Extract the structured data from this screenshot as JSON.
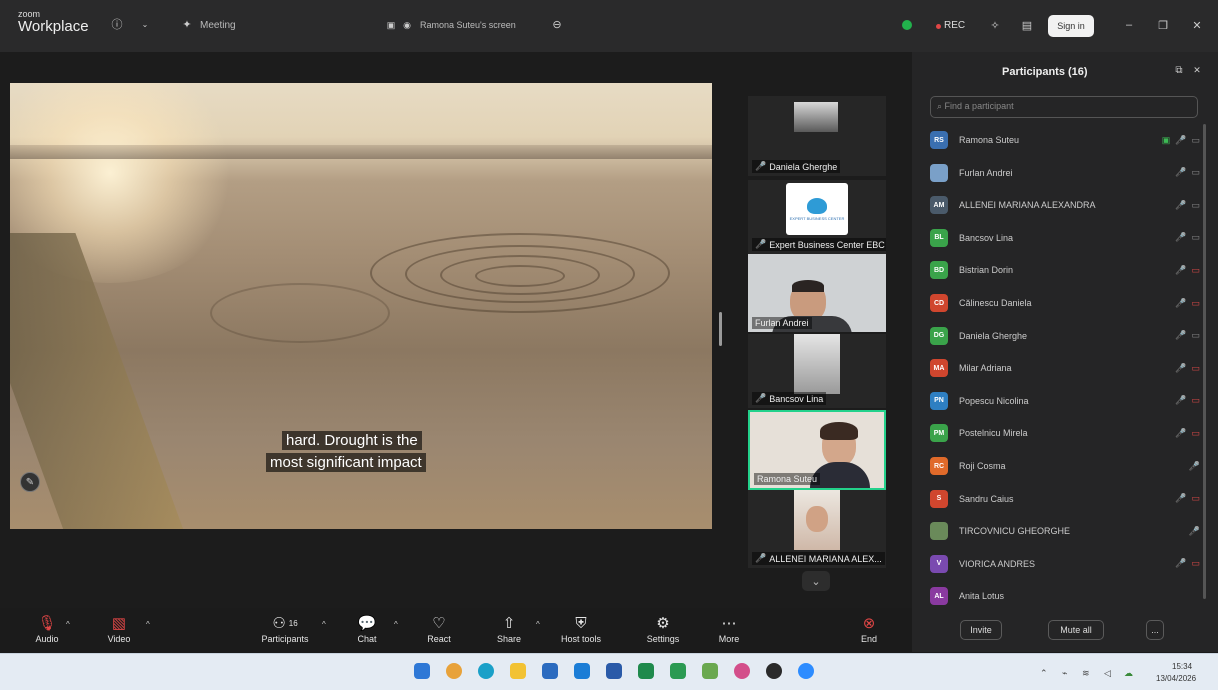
{
  "app": {
    "logo_small": "zoom",
    "logo_big": "Workplace",
    "meeting_label": "Meeting",
    "share_label": "Ramona Suteu's screen",
    "rec_label": "REC",
    "sign_in": "Sign in"
  },
  "window": {
    "minimize": "–",
    "maximize": "❐",
    "close": "✕"
  },
  "share": {
    "caption_line1": "hard. Drought is the",
    "caption_line2": "most significant impact"
  },
  "thumbnails": [
    {
      "name": "Daniela Gherghe"
    },
    {
      "name": "Expert Business Center EBC",
      "logo_text": "EXPERT BUSINESS CENTER"
    },
    {
      "name": "Furlan Andrei"
    },
    {
      "name": "Bancsov Lina"
    },
    {
      "name": "Ramona Suteu"
    },
    {
      "name": "ALLENEI MARIANA ALEX..."
    }
  ],
  "panel": {
    "title": "Participants (16)",
    "search_placeholder": "Find a participant",
    "participants": [
      {
        "initials": "RS",
        "name": "Ramona Suteu",
        "color": "#3a6fb0"
      },
      {
        "initials": "",
        "name": "Furlan Andrei",
        "color": "#7aa0c8"
      },
      {
        "initials": "AM",
        "name": "ALLENEI MARIANA ALEXANDRA",
        "color": "#4a5a6a"
      },
      {
        "initials": "BL",
        "name": "Bancsov Lina",
        "color": "#3aa34a"
      },
      {
        "initials": "BD",
        "name": "Bistrian Dorin",
        "color": "#3aa34a"
      },
      {
        "initials": "CD",
        "name": "Călinescu Daniela",
        "color": "#d0462e"
      },
      {
        "initials": "DG",
        "name": "Daniela Gherghe",
        "color": "#3aa34a"
      },
      {
        "initials": "MA",
        "name": "Milar Adriana",
        "color": "#d0462e"
      },
      {
        "initials": "PN",
        "name": "Popescu Nicolina",
        "color": "#2e7fc2"
      },
      {
        "initials": "PM",
        "name": "Postelnicu Mirela",
        "color": "#3aa34a"
      },
      {
        "initials": "RC",
        "name": "Roji Cosma",
        "color": "#e06a2a"
      },
      {
        "initials": "S",
        "name": "Sandru Caius",
        "color": "#d0462e"
      },
      {
        "initials": "",
        "name": "TIRCOVNICU GHEORGHE",
        "color": "#6a8a5a"
      },
      {
        "initials": "V",
        "name": "VIORICA ANDRES",
        "color": "#7a4ab0"
      },
      {
        "initials": "AL",
        "name": "Anita Lotus",
        "color": "#8a3aa0"
      }
    ],
    "invite": "Invite",
    "mute_all": "Mute all",
    "more": "..."
  },
  "toolbar": {
    "audio": "Audio",
    "video": "Video",
    "participants": "Participants",
    "participants_count": "16",
    "chat": "Chat",
    "react": "React",
    "share": "Share",
    "host_tools": "Host tools",
    "settings": "Settings",
    "more": "More",
    "end": "End"
  },
  "taskbar": {
    "time": "15:34",
    "date": "13/04/2026"
  }
}
